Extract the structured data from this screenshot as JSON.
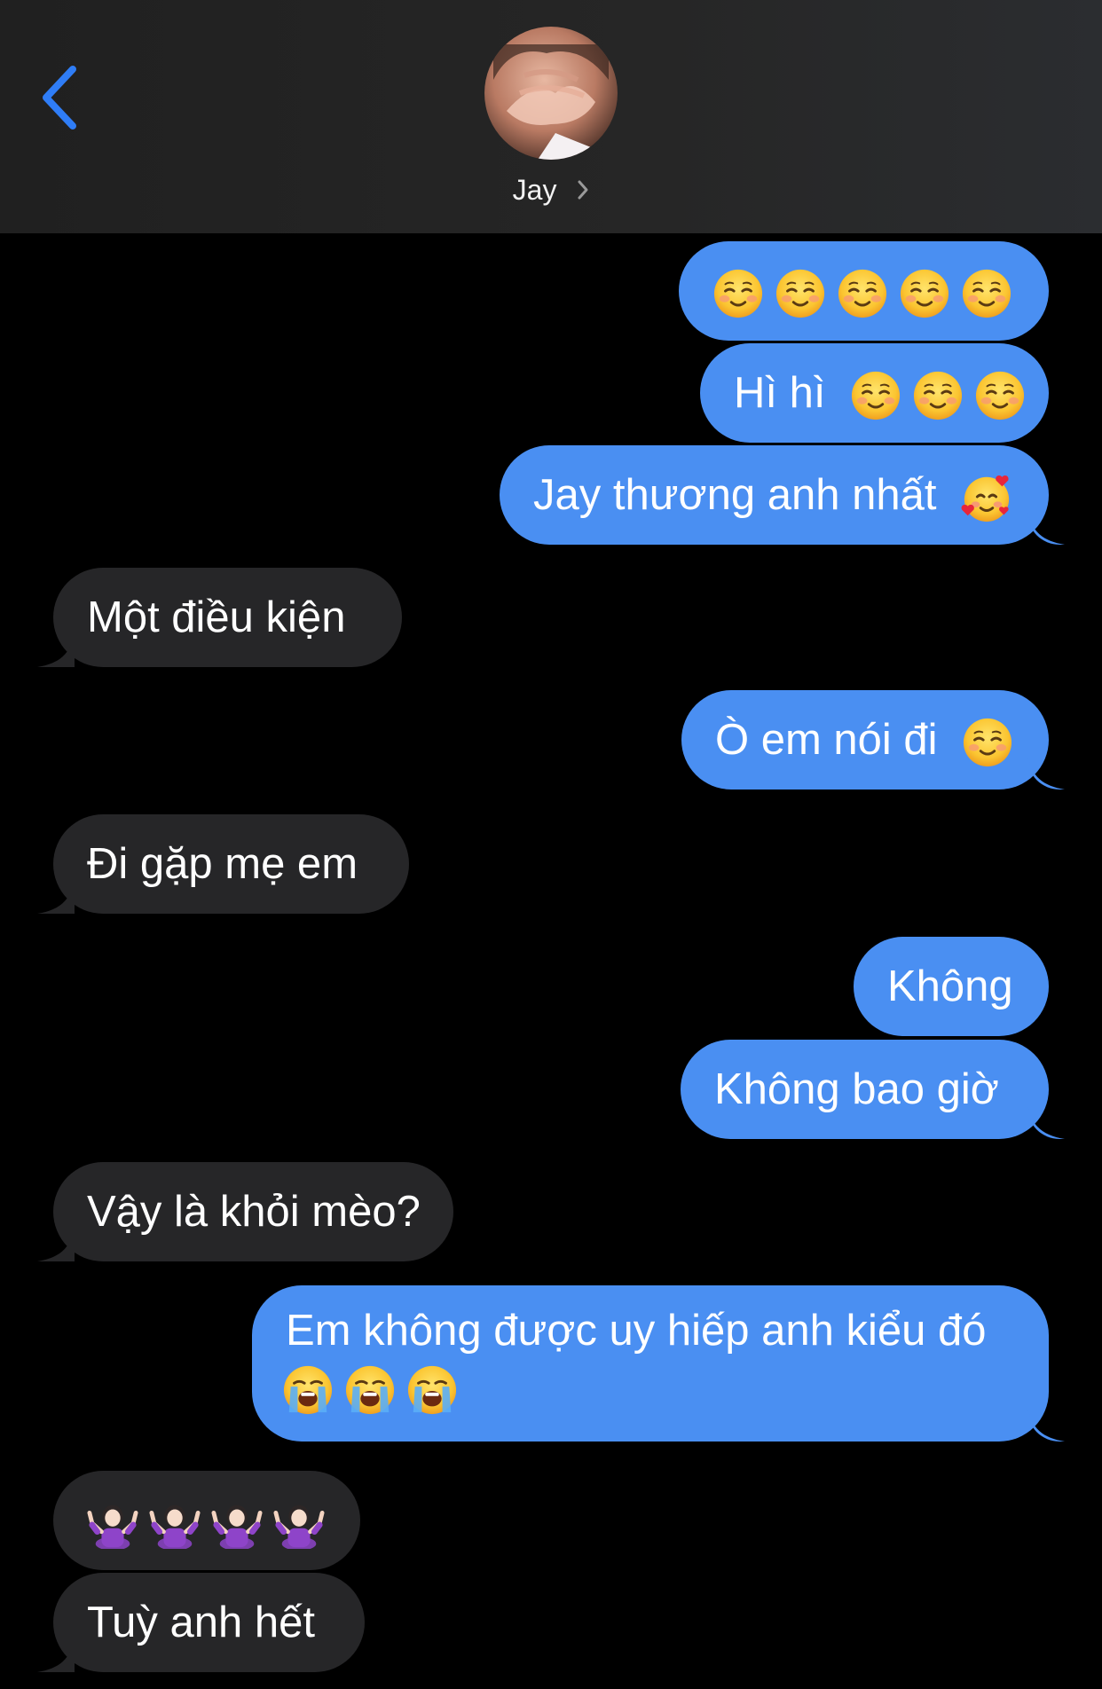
{
  "header": {
    "contact_name": "Jay",
    "back_icon": "chevron-left-icon",
    "detail_icon": "chevron-right-icon"
  },
  "colors": {
    "sent_bubble": "#4a8ff2",
    "received_bubble": "#262628",
    "accent": "#2f7df6",
    "background": "#000000"
  },
  "messages": [
    {
      "from": "me",
      "text": "",
      "emojis": [
        "smiling-face-icon",
        "smiling-face-icon",
        "smiling-face-icon",
        "smiling-face-icon",
        "smiling-face-icon"
      ]
    },
    {
      "from": "me",
      "text": "Hì hì",
      "emojis": [
        "smiling-face-icon",
        "smiling-face-icon",
        "smiling-face-icon"
      ]
    },
    {
      "from": "me",
      "text": "Jay thương anh nhất",
      "emojis": [
        "smiling-face-with-hearts-icon"
      ]
    },
    {
      "from": "them",
      "text": "Một điều kiện"
    },
    {
      "from": "me",
      "text": "Ò em nói đi",
      "emojis": [
        "smiling-face-icon"
      ]
    },
    {
      "from": "them",
      "text": "Đi gặp mẹ em"
    },
    {
      "from": "me",
      "text": "Không"
    },
    {
      "from": "me",
      "text": "Không bao giờ"
    },
    {
      "from": "them",
      "text": "Vậy là khỏi mèo?"
    },
    {
      "from": "me",
      "text": "Em không được uy hiếp anh kiểu đó",
      "emojis": [
        "loudly-crying-face-icon",
        "loudly-crying-face-icon",
        "loudly-crying-face-icon"
      ]
    },
    {
      "from": "them",
      "text": "",
      "emojis": [
        "person-shrugging-icon",
        "person-shrugging-icon",
        "person-shrugging-icon",
        "person-shrugging-icon"
      ]
    },
    {
      "from": "them",
      "text": "Tuỳ anh hết"
    }
  ]
}
